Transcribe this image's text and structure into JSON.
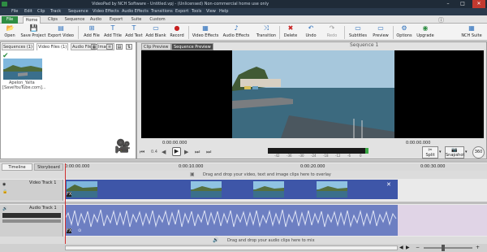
{
  "window": {
    "title": "VideoPad by NCH Software - Untitled.vpj - (Unlicensed) Non-commercial home use only",
    "buttons": [
      "–",
      "□",
      "✕"
    ]
  },
  "menu": [
    "File",
    "Edit",
    "Clip",
    "Track",
    "Sequence",
    "Video Effects",
    "Audio Effects",
    "Transitions",
    "Export",
    "Tools",
    "View",
    "Help"
  ],
  "ribbon_tabs": [
    "File",
    "Home",
    "Clips",
    "Sequence",
    "Audio",
    "Export",
    "Suite",
    "Custom"
  ],
  "toolbar": [
    {
      "label": "Open",
      "icon": "open-icon",
      "glyph": "📂"
    },
    {
      "label": "Save Project",
      "icon": "save-icon",
      "glyph": "💾"
    },
    {
      "label": "Export Video",
      "icon": "export-video-icon",
      "glyph": "▤"
    },
    {
      "label": "Add File",
      "icon": "add-file-icon",
      "glyph": "⊞"
    },
    {
      "label": "Add Title",
      "icon": "add-title-icon",
      "glyph": "T"
    },
    {
      "label": "Add Text",
      "icon": "add-text-icon",
      "glyph": "T"
    },
    {
      "label": "Add Blank",
      "icon": "add-blank-icon",
      "glyph": "▭"
    },
    {
      "label": "Record",
      "icon": "record-icon",
      "glyph": "●"
    },
    {
      "label": "Video Effects",
      "icon": "video-effects-icon",
      "glyph": "▦"
    },
    {
      "label": "Audio Effects",
      "icon": "audio-effects-icon",
      "glyph": "♪"
    },
    {
      "label": "Transition",
      "icon": "transition-icon",
      "glyph": "⤨"
    },
    {
      "label": "Delete",
      "icon": "delete-icon",
      "glyph": "✖"
    },
    {
      "label": "Undo",
      "icon": "undo-icon",
      "glyph": "↶"
    },
    {
      "label": "Redo",
      "icon": "redo-icon",
      "glyph": "↷"
    },
    {
      "label": "Subtitles",
      "icon": "subtitles-icon",
      "glyph": "▭"
    },
    {
      "label": "Preview",
      "icon": "preview-icon",
      "glyph": "▭"
    },
    {
      "label": "Options",
      "icon": "options-icon",
      "glyph": "⚙"
    },
    {
      "label": "Upgrade",
      "icon": "upgrade-icon",
      "glyph": "◉"
    },
    {
      "label": "NCH Suite",
      "icon": "nch-suite-icon",
      "glyph": "▦"
    }
  ],
  "bin": {
    "tabs": [
      "Sequences (1)",
      "Video Files (1)",
      "Audio Files",
      "Images"
    ],
    "clip_name": "Apelon_Yalta",
    "clip_sub": "[SaveYouTube.com]..."
  },
  "preview": {
    "tabs": [
      "Clip Preview",
      "Sequence Preview"
    ],
    "sequence_title": "Sequence 1",
    "time_left": "0:00:00.000",
    "time_right": "0:00:00.000",
    "meter_ticks": [
      "-42",
      "-36",
      "-30",
      "-24",
      "-18",
      "-12",
      "-6",
      "0"
    ],
    "split_label": "Split",
    "snapshot_label": "Snapshot",
    "deg_label": "360"
  },
  "timeline": {
    "tabs": [
      "Timeline",
      "Storyboard"
    ],
    "ruler": [
      "0:00:00.000",
      "0:00:10.000",
      "0:00:20.000",
      "0:00:30.000"
    ],
    "overlay_hint": "Drag and drop your video, text and image clips here to overlay",
    "video_track_label": "Video Track 1",
    "audio_track_label": "Audio Track 1",
    "audio_hint": "Drag and drop your audio clips here to mix"
  },
  "colors": {
    "accent_green": "#2e8d43",
    "clip_blue": "#3e56a8",
    "audio_blue": "#6d7fc2",
    "playhead": "#d03030"
  }
}
